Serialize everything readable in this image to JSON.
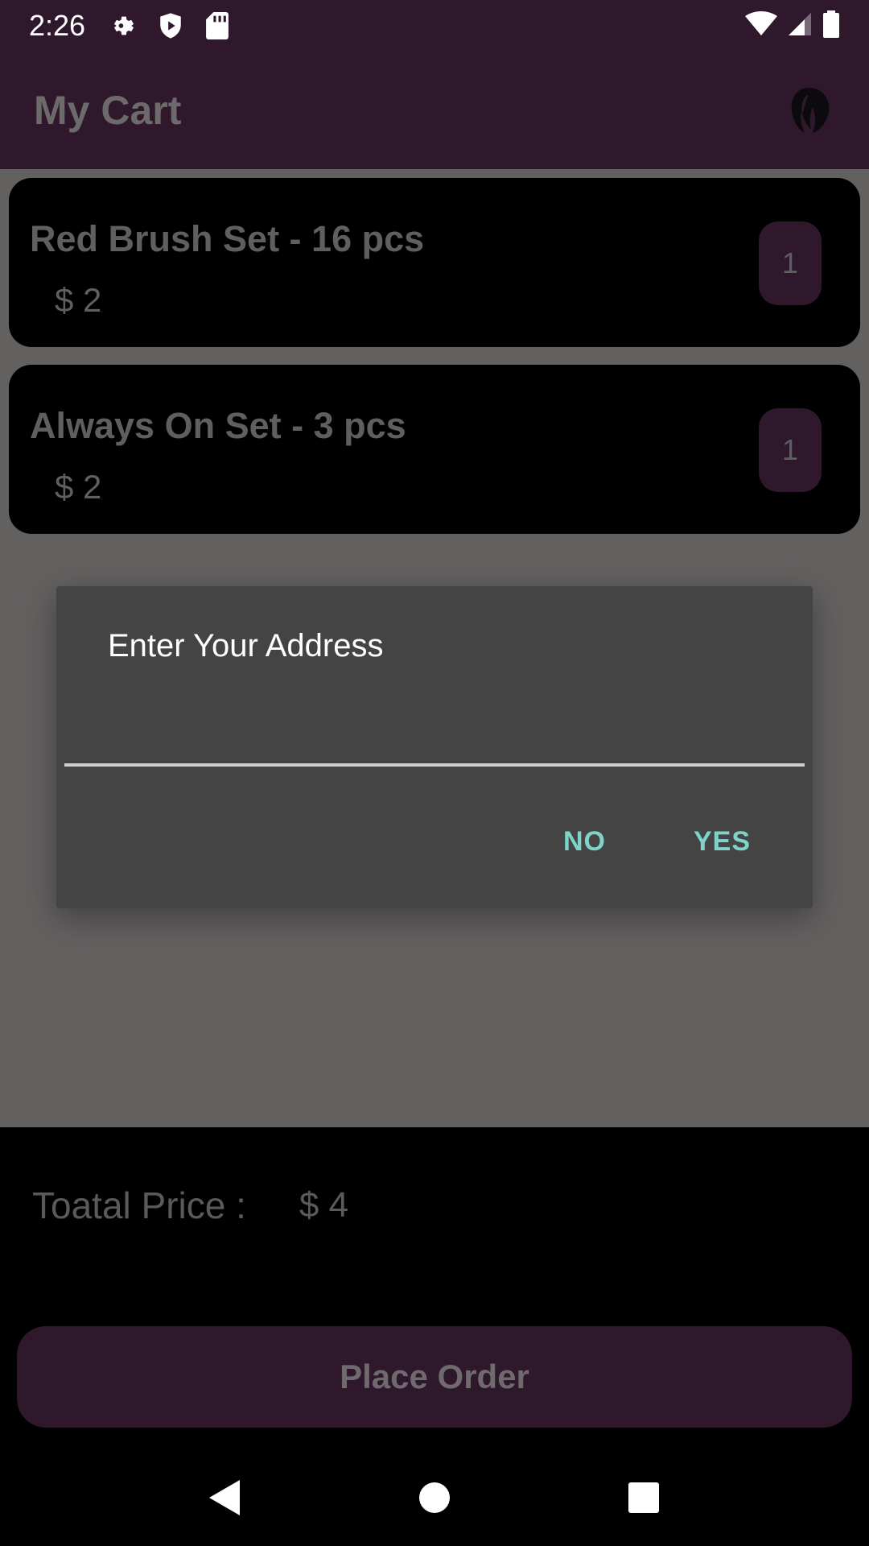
{
  "status_bar": {
    "time": "2:26",
    "icons_left": [
      "gear-icon",
      "shield-icon",
      "sd-card-icon"
    ],
    "icons_right": [
      "wifi-icon",
      "signal-icon",
      "battery-icon"
    ]
  },
  "app_bar": {
    "title": "My Cart",
    "logo_icon": "hair-silhouette-icon"
  },
  "cart": {
    "items": [
      {
        "name": "Red Brush Set - 16 pcs",
        "price": "$ 2",
        "quantity": "1"
      },
      {
        "name": "Always On Set - 3 pcs",
        "price": "$ 2",
        "quantity": "1"
      }
    ]
  },
  "dialog": {
    "title": "Enter Your Address",
    "input_value": "",
    "no_label": "NO",
    "yes_label": "YES"
  },
  "summary": {
    "total_label": "Toatal Price :",
    "total_value": "$ 4"
  },
  "place_order_label": "Place Order",
  "nav": {
    "icons": [
      "back-icon",
      "home-icon",
      "recents-icon"
    ]
  },
  "colors": {
    "app_bar": "#2f182c",
    "dialog_bg": "#444444",
    "dialog_accent": "#7fd3c8",
    "scrim": "#636060"
  }
}
